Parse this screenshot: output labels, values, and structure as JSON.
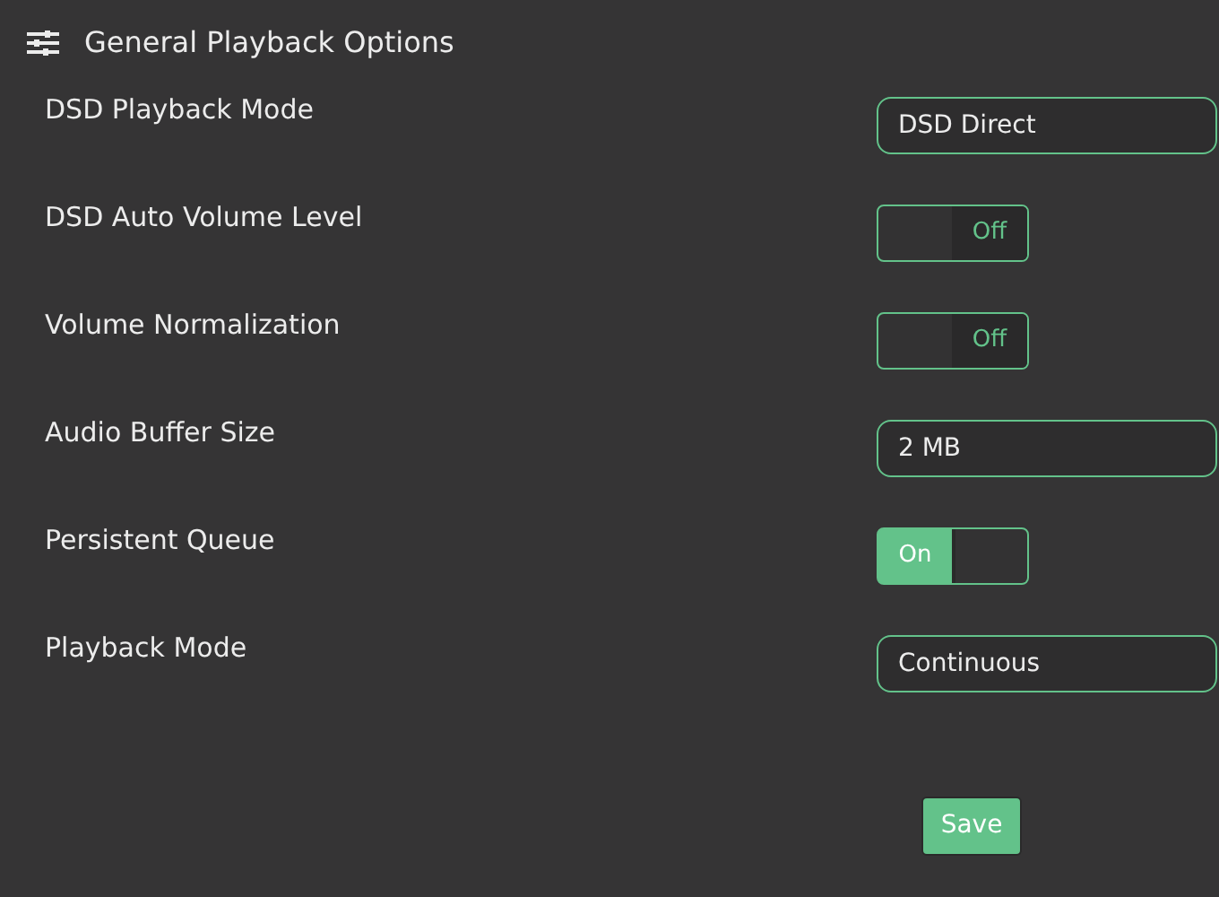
{
  "header": {
    "title": "General Playback Options"
  },
  "settings": [
    {
      "label": "DSD Playback Mode",
      "kind": "select",
      "value": "DSD Direct"
    },
    {
      "label": "DSD Auto Volume Level",
      "kind": "toggle",
      "on": false,
      "state_label": "Off"
    },
    {
      "label": "Volume Normalization",
      "kind": "toggle",
      "on": false,
      "state_label": "Off"
    },
    {
      "label": "Audio Buffer Size",
      "kind": "select",
      "value": "2 MB"
    },
    {
      "label": "Persistent Queue",
      "kind": "toggle",
      "on": true,
      "state_label": "On"
    },
    {
      "label": "Playback Mode",
      "kind": "select",
      "value": "Continuous"
    }
  ],
  "save_button": "Save"
}
